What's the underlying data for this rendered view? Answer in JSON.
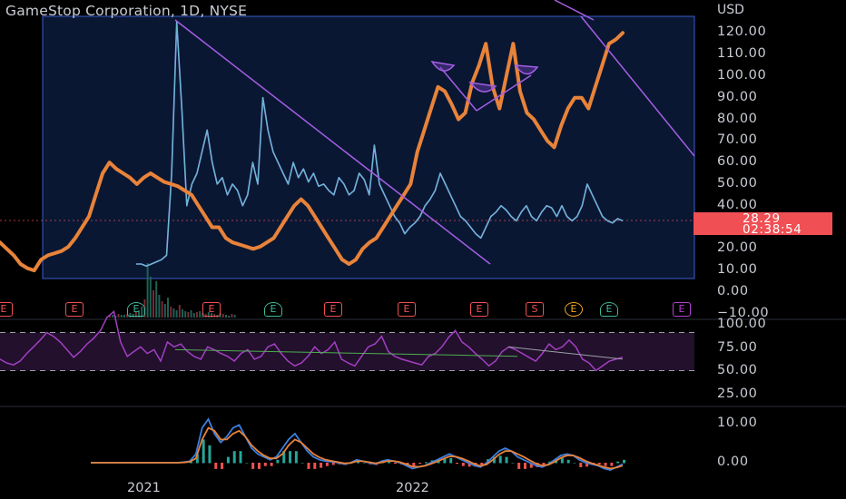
{
  "chart_data": {
    "type": "line",
    "title": "GameStop Corporation, 1D, NYSE",
    "currency": "USD",
    "x_labels": [
      "2021",
      "2022"
    ],
    "y_ticks_main": [
      "120.00",
      "110.00",
      "100.00",
      "90.00",
      "80.00",
      "70.00",
      "60.00",
      "50.00",
      "40.00",
      "30.00",
      "20.00",
      "10.00",
      "0.00",
      "−10.00"
    ],
    "ylim_main": [
      -10,
      120
    ],
    "last_price": "28.29",
    "countdown": "02:38:54",
    "series": [
      {
        "color": "#8fb4ff",
        "values": [
          8,
          8,
          7,
          8,
          9,
          10,
          12,
          50,
          120,
          80,
          35,
          45,
          50,
          60,
          70,
          55,
          45,
          48,
          40,
          45,
          42,
          35,
          40,
          55,
          45,
          85,
          70,
          60,
          55,
          50,
          45,
          55,
          48,
          52,
          46,
          50,
          44,
          45,
          42,
          40,
          48,
          45,
          40,
          42,
          50,
          47,
          40,
          63,
          45,
          40,
          35,
          30,
          27,
          22,
          25,
          27,
          30,
          35,
          38,
          42,
          50,
          45,
          40,
          35,
          30,
          28,
          25,
          22,
          20,
          25,
          30,
          32,
          35,
          33,
          30,
          28,
          32,
          35,
          30,
          28,
          32,
          35,
          34,
          30,
          35,
          30,
          28,
          30,
          35,
          45,
          40,
          35,
          30,
          28,
          27,
          29,
          28
        ]
      },
      {
        "color": "#e8833a",
        "values": [
          18,
          15,
          12,
          8,
          6,
          5,
          10,
          12,
          13,
          14,
          16,
          20,
          25,
          30,
          40,
          50,
          55,
          52,
          50,
          48,
          45,
          48,
          50,
          48,
          46,
          45,
          44,
          42,
          40,
          35,
          30,
          25,
          25,
          20,
          18,
          17,
          16,
          15,
          16,
          18,
          20,
          25,
          30,
          35,
          38,
          35,
          30,
          25,
          20,
          15,
          10,
          8,
          10,
          15,
          18,
          20,
          25,
          30,
          35,
          40,
          45,
          60,
          70,
          80,
          90,
          88,
          82,
          75,
          78,
          92,
          100,
          110,
          90,
          80,
          95,
          110,
          88,
          78,
          75,
          70,
          65,
          62,
          72,
          80,
          85,
          85,
          80,
          90,
          100,
          110,
          112,
          115
        ]
      }
    ],
    "rsi": {
      "ylim": [
        0,
        100
      ],
      "y_ticks": [
        "100.00",
        "75.00",
        "50.00",
        "25.00"
      ],
      "levels": [
        70,
        30
      ],
      "color": "#a33fc4",
      "values": [
        42,
        38,
        36,
        40,
        48,
        55,
        62,
        70,
        66,
        60,
        52,
        44,
        50,
        58,
        64,
        72,
        86,
        92,
        60,
        45,
        50,
        55,
        48,
        52,
        40,
        60,
        55,
        58,
        50,
        45,
        42,
        55,
        52,
        48,
        45,
        40,
        48,
        52,
        42,
        45,
        55,
        58,
        48,
        40,
        35,
        38,
        45,
        55,
        48,
        52,
        60,
        42,
        38,
        35,
        45,
        55,
        58,
        66,
        50,
        45,
        42,
        40,
        38,
        36,
        45,
        48,
        55,
        65,
        72,
        60,
        55,
        48,
        42,
        35,
        40,
        50,
        55,
        52,
        48,
        44,
        40,
        48,
        58,
        52,
        55,
        62,
        55,
        42,
        38,
        30,
        35,
        40,
        42,
        44
      ]
    },
    "macd": {
      "y_ticks": [
        "10.00",
        "0.00"
      ],
      "ylim": [
        -3,
        17
      ],
      "macd_color": "#3d7fe0",
      "signal_color": "#e8833a",
      "macd": [
        0,
        0,
        0,
        0,
        0,
        0,
        0,
        0,
        0,
        0,
        0,
        0,
        0,
        0,
        0,
        0.2,
        0.5,
        3,
        12,
        15,
        10,
        7,
        9,
        12,
        13,
        9,
        5,
        3,
        2,
        1,
        2,
        5,
        8,
        10,
        7,
        4,
        2,
        1,
        0.5,
        0.3,
        0,
        -0.5,
        0,
        1,
        0.5,
        0,
        -0.5,
        0.5,
        1,
        0.5,
        0,
        -1,
        -2,
        -1.5,
        -1,
        0,
        1,
        2,
        3,
        2,
        1,
        0,
        -1,
        -1.5,
        0,
        2,
        4,
        5,
        4,
        2,
        1,
        0,
        -1,
        -1.5,
        -0.5,
        1,
        2.5,
        3,
        2.5,
        1,
        0,
        -0.5,
        -1,
        -2,
        -2.5,
        -1.5,
        -0.5
      ],
      "signal": [
        0,
        0,
        0,
        0,
        0,
        0,
        0,
        0,
        0,
        0,
        0,
        0,
        0,
        0,
        0,
        0.1,
        0.3,
        1.5,
        8,
        12,
        11,
        8,
        8,
        10,
        11,
        9,
        6,
        4,
        2.5,
        1.5,
        1.5,
        3,
        6,
        8,
        7,
        5,
        3,
        1.8,
        1,
        0.6,
        0.2,
        -0.2,
        -0.1,
        0.5,
        0.5,
        0.2,
        -0.2,
        0.1,
        0.6,
        0.6,
        0.2,
        -0.5,
        -1.3,
        -1.4,
        -1.1,
        -0.4,
        0.4,
        1.3,
        2.2,
        2.1,
        1.5,
        0.6,
        -0.4,
        -1.1,
        -0.6,
        1,
        2.8,
        4,
        4,
        3,
        2,
        0.8,
        -0.3,
        -1,
        -0.7,
        0.3,
        1.7,
        2.5,
        2.5,
        1.7,
        0.6,
        -0.2,
        -0.8,
        -1.5,
        -2,
        -1.7,
        -1
      ]
    }
  },
  "earnings_markers": [
    "E",
    "E",
    "E",
    "E",
    "E",
    "E",
    "E",
    "E",
    "S",
    "E",
    "E"
  ]
}
